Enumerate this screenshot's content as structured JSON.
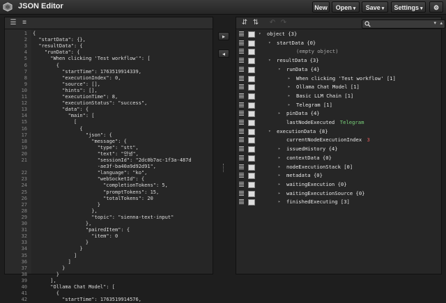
{
  "app": {
    "title": "JSON Editor"
  },
  "toolbar": {
    "new_label": "New",
    "open_label": "Open",
    "save_label": "Save",
    "settings_label": "Settings",
    "caret": "▾",
    "gear": "⚙"
  },
  "mid": {
    "copy_right": "▸",
    "copy_left": "◂"
  },
  "code": {
    "line_numbers": [
      1,
      2,
      3,
      4,
      5,
      6,
      7,
      8,
      9,
      10,
      11,
      12,
      13,
      14,
      15,
      16,
      17,
      18,
      19,
      20,
      21,
      "",
      22,
      23,
      24,
      25,
      26,
      27,
      28,
      29,
      30,
      31,
      32,
      33,
      34,
      35,
      36,
      37,
      38,
      39,
      40,
      41,
      42
    ],
    "lines": [
      "{",
      "  \"startData\": {},",
      "  \"resultData\": {",
      "    \"runData\": {",
      "      \"When clicking 'Test workflow'\": [",
      "        {",
      "          \"startTime\": 1763519914339,",
      "          \"executionIndex\": 0,",
      "          \"source\": [],",
      "          \"hints\": [],",
      "          \"executionTime\": 8,",
      "          \"executionStatus\": \"success\",",
      "          \"data\": {",
      "            \"main\": [",
      "              [",
      "                {",
      "                  \"json\": {",
      "                    \"message\": {",
      "                      \"type\": \"stt\",",
      "                      \"text\": \"안녕\",",
      "                      \"sessionId\": \"2dc0b7ac-1f3a-487d",
      "                      -ae3f-ba40a9d92d91\",",
      "                      \"language\": \"ko\",",
      "                      \"webSocketId\": {",
      "                        \"completionTokens\": 5,",
      "                        \"promptTokens\": 15,",
      "                        \"totalTokens\": 20",
      "                      }",
      "                    },",
      "                    \"topic\": \"sienna-text-input\"",
      "                  },",
      "                  \"pairedItem\": {",
      "                    \"item\": 0",
      "                  }",
      "                }",
      "              ]",
      "            ]",
      "          }",
      "        }",
      "      ],",
      "      \"Ollama Chat Model\": [",
      "        {",
      "          \"startTime\": 1763519914576,"
    ]
  },
  "tree": {
    "rows": [
      {
        "indent": 0,
        "tw": "▾",
        "name": "object {3}",
        "value": "",
        "vclass": ""
      },
      {
        "indent": 1,
        "tw": "▾",
        "name": "startData {0}",
        "value": "",
        "vclass": ""
      },
      {
        "indent": 3,
        "tw": "",
        "name": "",
        "value": "(empty object)",
        "vclass": ""
      },
      {
        "indent": 1,
        "tw": "▾",
        "name": "resultData {3}",
        "value": "",
        "vclass": ""
      },
      {
        "indent": 2,
        "tw": "▾",
        "name": "runData {4}",
        "value": "",
        "vclass": ""
      },
      {
        "indent": 3,
        "tw": "▸",
        "name": "When clicking 'Test workflow' [1]",
        "value": "",
        "vclass": ""
      },
      {
        "indent": 3,
        "tw": "▸",
        "name": "Ollama Chat Model [1]",
        "value": "",
        "vclass": ""
      },
      {
        "indent": 3,
        "tw": "▸",
        "name": "Basic LLM Chain [1]",
        "value": "",
        "vclass": ""
      },
      {
        "indent": 3,
        "tw": "▸",
        "name": "Telegram [1]",
        "value": "",
        "vclass": ""
      },
      {
        "indent": 2,
        "tw": "▸",
        "name": "pinData {4}",
        "value": "",
        "vclass": ""
      },
      {
        "indent": 2,
        "tw": "",
        "name": "lastNodeExecuted",
        "value": "Telegram",
        "vclass": "green"
      },
      {
        "indent": 1,
        "tw": "▾",
        "name": "executionData {8}",
        "value": "",
        "vclass": ""
      },
      {
        "indent": 2,
        "tw": "",
        "name": "currentNodeExecutionIndex",
        "value": "3",
        "vclass": "red"
      },
      {
        "indent": 2,
        "tw": "▸",
        "name": "issuedHistory {4}",
        "value": "",
        "vclass": ""
      },
      {
        "indent": 2,
        "tw": "▸",
        "name": "contextData {0}",
        "value": "",
        "vclass": ""
      },
      {
        "indent": 2,
        "tw": "▸",
        "name": "nodeExecutionStack [0]",
        "value": "",
        "vclass": ""
      },
      {
        "indent": 2,
        "tw": "▸",
        "name": "metadata {0}",
        "value": "",
        "vclass": ""
      },
      {
        "indent": 2,
        "tw": "▸",
        "name": "waitingExecution {0}",
        "value": "",
        "vclass": ""
      },
      {
        "indent": 2,
        "tw": "▸",
        "name": "waitingExecutionSource {0}",
        "value": "",
        "vclass": ""
      },
      {
        "indent": 2,
        "tw": "▸",
        "name": "finishedExecuting [3]",
        "value": "",
        "vclass": ""
      }
    ]
  }
}
